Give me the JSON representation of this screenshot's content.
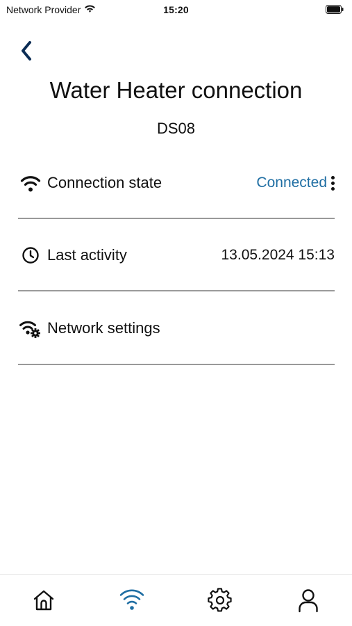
{
  "status_bar": {
    "carrier": "Network Provider",
    "time": "15:20"
  },
  "header": {
    "title": "Water Heater connection",
    "device_id": "DS08"
  },
  "rows": [
    {
      "label": "Connection state",
      "value": "Connected",
      "icon": "wifi-icon"
    },
    {
      "label": "Last activity",
      "value": "13.05.2024 15:13",
      "icon": "clock-icon"
    },
    {
      "label": "Network settings",
      "icon": "wifi-settings-icon"
    }
  ],
  "tab_bar": {
    "tabs": [
      {
        "name": "home",
        "icon": "home-icon"
      },
      {
        "name": "connection",
        "icon": "wifi-icon",
        "active": true
      },
      {
        "name": "settings",
        "icon": "gear-icon"
      },
      {
        "name": "profile",
        "icon": "user-icon"
      }
    ]
  },
  "colors": {
    "accent": "#1f6ea3",
    "navy": "#0b2d55",
    "text": "#111111",
    "divider": "#9a9a9a"
  }
}
